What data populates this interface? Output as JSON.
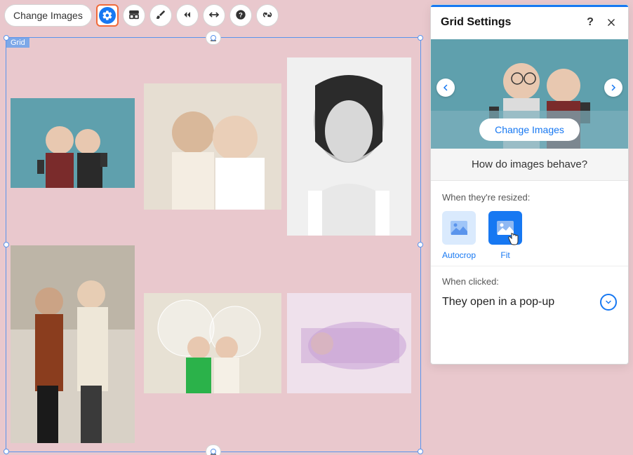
{
  "toolbar": {
    "change_images": "Change Images",
    "icon_gear": "gear-icon",
    "icon_layout": "layout-icon",
    "icon_brush": "brush-icon",
    "icon_animate": "animate-icon",
    "icon_stretch": "stretch-icon",
    "icon_help": "help-icon",
    "icon_link": "link-icon"
  },
  "grid": {
    "label": "Grid"
  },
  "panel": {
    "title": "Grid Settings",
    "help_icon": "?",
    "change_images": "Change Images",
    "behave_question": "How do images behave?",
    "resize_label": "When they're resized:",
    "option_autocrop": "Autocrop",
    "option_fit": "Fit",
    "click_label": "When clicked:",
    "click_value": "They open in a pop-up"
  }
}
